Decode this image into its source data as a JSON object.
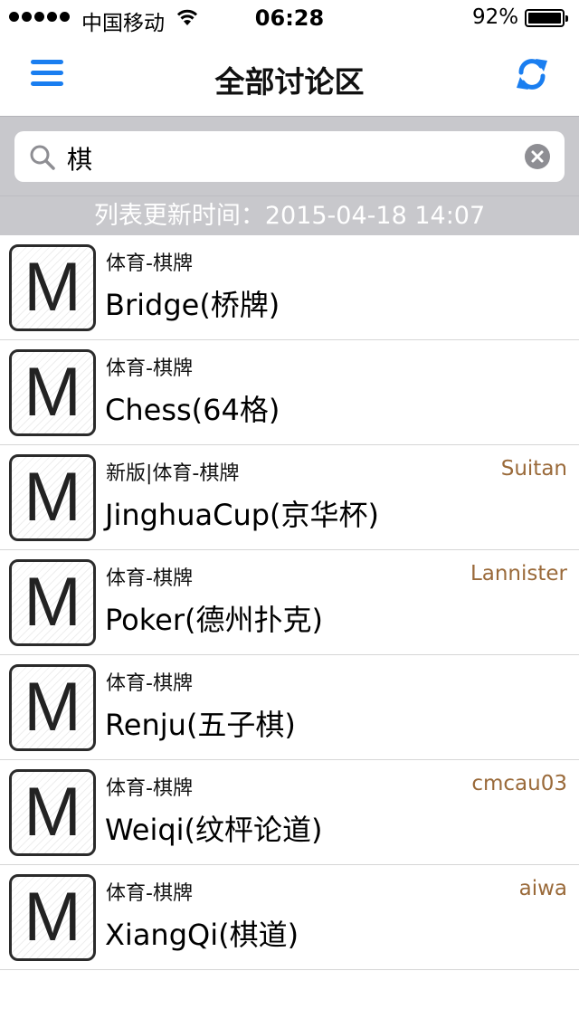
{
  "status_bar": {
    "carrier": "中国移动",
    "time": "06:28",
    "battery": "92%"
  },
  "nav": {
    "title": "全部讨论区",
    "menu_icon": "hamburger-menu-icon",
    "refresh_icon": "refresh-icon",
    "accent_color": "#1a7ef0"
  },
  "search": {
    "query": "棋",
    "search_icon": "magnifier-icon",
    "clear_icon": "clear-icon"
  },
  "update_time": "列表更新时间：2015-04-18 14:07",
  "boards": [
    {
      "icon": "M",
      "category": "体育-棋牌",
      "title": "Bridge(桥牌)",
      "moderator": ""
    },
    {
      "icon": "M",
      "category": "体育-棋牌",
      "title": "Chess(64格)",
      "moderator": ""
    },
    {
      "icon": "M",
      "category": "新版|体育-棋牌",
      "title": "JinghuaCup(京华杯)",
      "moderator": "Suitan"
    },
    {
      "icon": "M",
      "category": "体育-棋牌",
      "title": "Poker(德州扑克)",
      "moderator": "Lannister"
    },
    {
      "icon": "M",
      "category": "体育-棋牌",
      "title": "Renju(五子棋)",
      "moderator": ""
    },
    {
      "icon": "M",
      "category": "体育-棋牌",
      "title": "Weiqi(纹枰论道)",
      "moderator": "cmcau03"
    },
    {
      "icon": "M",
      "category": "体育-棋牌",
      "title": "XiangQi(棋道)",
      "moderator": "aiwa"
    }
  ]
}
